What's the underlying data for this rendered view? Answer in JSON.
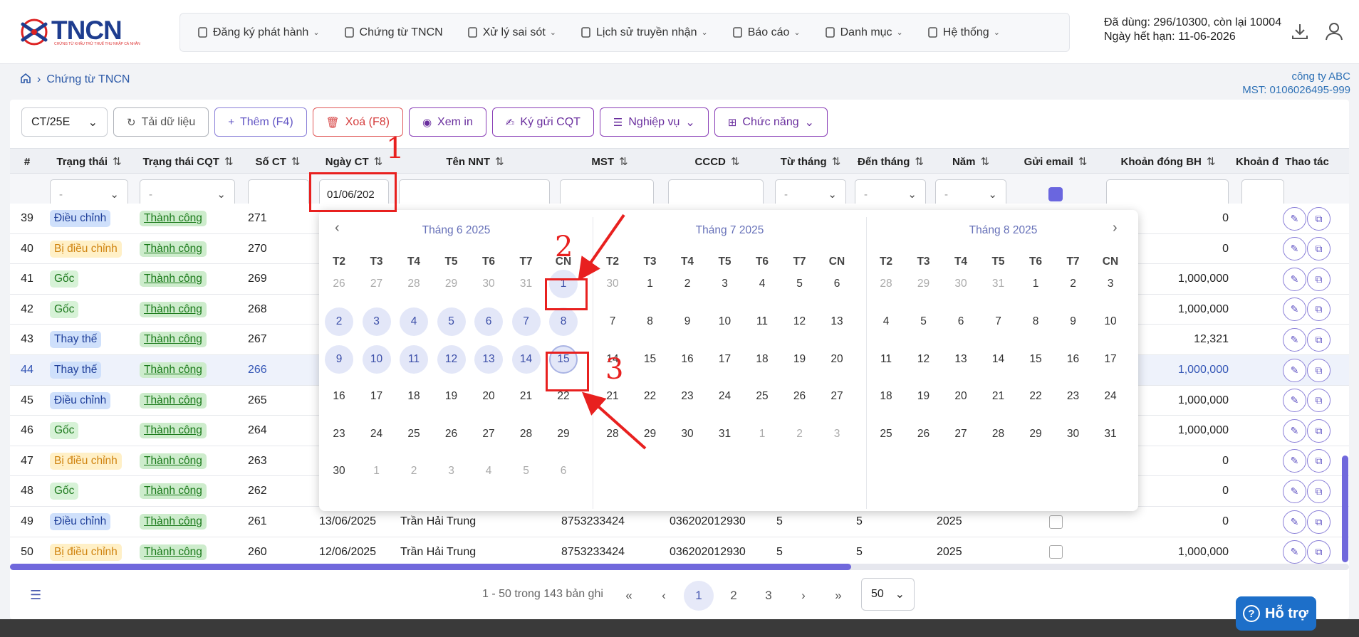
{
  "brand": {
    "name": "TNCN",
    "tagline": "CHỨNG TỪ KHẤU TRỪ THUẾ THU NHẬP CÁ NHÂN"
  },
  "nav": [
    {
      "label": "Đăng ký phát hành",
      "icon": "document-icon",
      "chevron": true
    },
    {
      "label": "Chứng từ TNCN",
      "icon": "receipt-icon",
      "chevron": false
    },
    {
      "label": "Xử lý sai sót",
      "icon": "document-edit-icon",
      "chevron": true
    },
    {
      "label": "Lịch sử truyền nhận",
      "icon": "transfer-icon",
      "chevron": true
    },
    {
      "label": "Báo cáo",
      "icon": "chart-icon",
      "chevron": true
    },
    {
      "label": "Danh mục",
      "icon": "grid-icon",
      "chevron": true
    },
    {
      "label": "Hệ thống",
      "icon": "gear-icon",
      "chevron": true
    }
  ],
  "usage": {
    "line1": "Đã dùng: 296/10300, còn lại 10004",
    "line2": "Ngày hết hạn: 11-06-2026"
  },
  "breadcrumb": {
    "current": "Chứng từ TNCN"
  },
  "company": {
    "name": "công ty ABC",
    "mst": "MST: 0106026495-999"
  },
  "toolbar": {
    "template": "CT/25E",
    "reload": "Tải dữ liệu",
    "add": "Thêm (F4)",
    "delete": "Xoá (F8)",
    "print": "Xem in",
    "sign": "Ký gửi CQT",
    "ops": "Nghiệp vụ",
    "func": "Chức năng"
  },
  "columns": [
    "#",
    "Trạng thái",
    "Trạng thái CQT",
    "Số CT",
    "Ngày CT",
    "Tên NNT",
    "MST",
    "CCCD",
    "Từ tháng",
    "Đến tháng",
    "Năm",
    "Gửi email",
    "Khoản đóng BH",
    "Khoản đ",
    "Thao tác"
  ],
  "filters": {
    "status": "-",
    "cqt_status": "-",
    "date": "01/06/202",
    "from_month": "-",
    "to_month": "-",
    "year": "-"
  },
  "rows": [
    {
      "n": "39",
      "status": "Điều chỉnh",
      "st": "dc",
      "cqt": "Thành công",
      "so": "271",
      "date": "",
      "name": "",
      "mst": "",
      "cccd": "",
      "from": "",
      "to": "",
      "year": "",
      "bh": "0",
      "hl": false
    },
    {
      "n": "40",
      "status": "Bị điều chỉnh",
      "st": "bdc",
      "cqt": "Thành công",
      "so": "270",
      "date": "",
      "name": "",
      "mst": "",
      "cccd": "",
      "from": "",
      "to": "",
      "year": "",
      "bh": "0",
      "hl": false
    },
    {
      "n": "41",
      "status": "Gốc",
      "st": "goc",
      "cqt": "Thành công",
      "so": "269",
      "date": "",
      "name": "",
      "mst": "",
      "cccd": "",
      "from": "",
      "to": "",
      "year": "",
      "bh": "1,000,000",
      "hl": false
    },
    {
      "n": "42",
      "status": "Gốc",
      "st": "goc",
      "cqt": "Thành công",
      "so": "268",
      "date": "",
      "name": "",
      "mst": "",
      "cccd": "",
      "from": "",
      "to": "",
      "year": "",
      "bh": "1,000,000",
      "hl": false
    },
    {
      "n": "43",
      "status": "Thay thế",
      "st": "tt",
      "cqt": "Thành công",
      "so": "267",
      "date": "",
      "name": "",
      "mst": "",
      "cccd": "",
      "from": "",
      "to": "",
      "year": "",
      "bh": "12,321",
      "hl": false
    },
    {
      "n": "44",
      "status": "Thay thế",
      "st": "tt",
      "cqt": "Thành công",
      "so": "266",
      "date": "",
      "name": "",
      "mst": "",
      "cccd": "",
      "from": "",
      "to": "",
      "year": "",
      "bh": "1,000,000",
      "hl": true
    },
    {
      "n": "45",
      "status": "Điều chỉnh",
      "st": "dc",
      "cqt": "Thành công",
      "so": "265",
      "date": "",
      "name": "",
      "mst": "",
      "cccd": "",
      "from": "",
      "to": "",
      "year": "",
      "bh": "1,000,000",
      "hl": false
    },
    {
      "n": "46",
      "status": "Gốc",
      "st": "goc",
      "cqt": "Thành công",
      "so": "264",
      "date": "",
      "name": "",
      "mst": "",
      "cccd": "",
      "from": "",
      "to": "",
      "year": "",
      "bh": "1,000,000",
      "hl": false
    },
    {
      "n": "47",
      "status": "Bị điều chỉnh",
      "st": "bdc",
      "cqt": "Thành công",
      "so": "263",
      "date": "",
      "name": "",
      "mst": "",
      "cccd": "",
      "from": "",
      "to": "",
      "year": "",
      "bh": "0",
      "hl": false
    },
    {
      "n": "48",
      "status": "Gốc",
      "st": "goc",
      "cqt": "Thành công",
      "so": "262",
      "date": "",
      "name": "",
      "mst": "",
      "cccd": "",
      "from": "",
      "to": "",
      "year": "",
      "bh": "0",
      "hl": false
    },
    {
      "n": "49",
      "status": "Điều chỉnh",
      "st": "dc",
      "cqt": "Thành công",
      "so": "261",
      "date": "13/06/2025",
      "name": "Trần Hải Trung",
      "mst": "8753233424",
      "cccd": "036202012930",
      "from": "5",
      "to": "5",
      "year": "2025",
      "bh": "0",
      "hl": false
    },
    {
      "n": "50",
      "status": "Bị điều chỉnh",
      "st": "bdc",
      "cqt": "Thành công",
      "so": "260",
      "date": "12/06/2025",
      "name": "Trần Hải Trung",
      "mst": "8753233424",
      "cccd": "036202012930",
      "from": "5",
      "to": "5",
      "year": "2025",
      "bh": "1,000,000",
      "hl": false
    }
  ],
  "calendar": {
    "weekdays": [
      "T2",
      "T3",
      "T4",
      "T5",
      "T6",
      "T7",
      "CN"
    ],
    "months": [
      {
        "title": "Tháng 6  2025",
        "days": [
          "26",
          "27",
          "28",
          "29",
          "30",
          "31",
          "1",
          "2",
          "3",
          "4",
          "5",
          "6",
          "7",
          "8",
          "9",
          "10",
          "11",
          "12",
          "13",
          "14",
          "15",
          "16",
          "17",
          "18",
          "19",
          "20",
          "21",
          "22",
          "23",
          "24",
          "25",
          "26",
          "27",
          "28",
          "29",
          "30",
          "1",
          "2",
          "3",
          "4",
          "5",
          "6"
        ],
        "lead": 6,
        "count": 30,
        "range": [
          1,
          15
        ]
      },
      {
        "title": "Tháng 7  2025",
        "days": [
          "30",
          "1",
          "2",
          "3",
          "4",
          "5",
          "6",
          "7",
          "8",
          "9",
          "10",
          "11",
          "12",
          "13",
          "14",
          "15",
          "16",
          "17",
          "18",
          "19",
          "20",
          "21",
          "22",
          "23",
          "24",
          "25",
          "26",
          "27",
          "28",
          "29",
          "30",
          "31",
          "1",
          "2",
          "3"
        ],
        "lead": 1,
        "count": 31,
        "range": []
      },
      {
        "title": "Tháng 8  2025",
        "days": [
          "28",
          "29",
          "30",
          "31",
          "1",
          "2",
          "3",
          "4",
          "5",
          "6",
          "7",
          "8",
          "9",
          "10",
          "11",
          "12",
          "13",
          "14",
          "15",
          "16",
          "17",
          "18",
          "19",
          "20",
          "21",
          "22",
          "23",
          "24",
          "25",
          "26",
          "27",
          "28",
          "29",
          "30",
          "31"
        ],
        "lead": 4,
        "count": 31,
        "range": []
      }
    ]
  },
  "annotations": [
    "1",
    "2",
    "3"
  ],
  "pager": {
    "info": "1 - 50 trong 143 bản ghi",
    "pages": [
      "1",
      "2",
      "3"
    ],
    "size": "50"
  },
  "support": "Hỗ trợ"
}
